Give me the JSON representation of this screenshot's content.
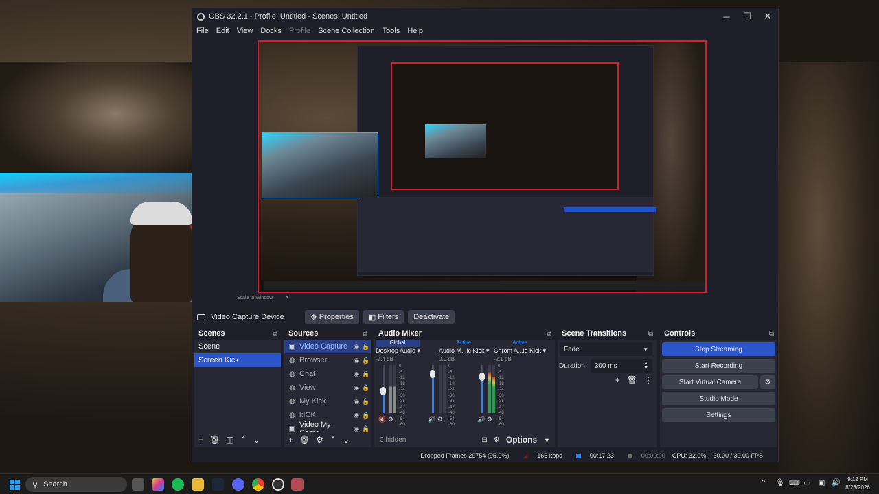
{
  "window": {
    "title": "OBS 32.2.1 - Profile: Untitled - Scenes: Untitled",
    "minimize": "─",
    "maximize": "☐",
    "close": "✕"
  },
  "menu": [
    "File",
    "Edit",
    "View",
    "Docks",
    "Profile",
    "Scene Collection",
    "Tools",
    "Help"
  ],
  "preview": {
    "scale_label": "Scale to Window"
  },
  "source_toolbar": {
    "source_name": "Video Capture Device",
    "properties": "Properties",
    "filters": "Filters",
    "deactivate": "Deactivate"
  },
  "scenes": {
    "title": "Scenes",
    "items": [
      "Scene",
      "Screen Kick"
    ],
    "active_index": 1
  },
  "sources": {
    "title": "Sources",
    "items": [
      "Video Capture",
      "Browser",
      "Chat",
      "View",
      "My Kick",
      "kICK",
      "Video My Came"
    ]
  },
  "mixer": {
    "title": "Audio Mixer",
    "channels": [
      {
        "tab": "Global",
        "name": "Desktop Audio",
        "db": "-7.4 dB",
        "level": 0.45
      },
      {
        "tab": "Active",
        "name": "Audio M...lc Kick",
        "db": "0.0 dB",
        "level": 0.82
      },
      {
        "tab": "Active",
        "name": "Chrom A...lo Kick",
        "db": "-2.1 dB",
        "level": 0.75
      }
    ],
    "scale": [
      "0",
      "-5",
      "-12",
      "-18",
      "-24",
      "-30",
      "-36",
      "-42",
      "-48",
      "-54",
      "-60"
    ],
    "hidden": "0 hidden",
    "options": "Options"
  },
  "transitions": {
    "title": "Scene Transitions",
    "type": "Fade",
    "duration_label": "Duration",
    "duration": "300 ms"
  },
  "controls": {
    "title": "Controls",
    "stop_streaming": "Stop Streaming",
    "start_recording": "Start Recording",
    "start_virtual_camera": "Start Virtual Camera",
    "studio_mode": "Studio Mode",
    "settings": "Settings"
  },
  "status": {
    "dropped": "Dropped Frames 29754 (95.0%)",
    "bitrate": "166 kbps",
    "stream_time": "00:17:23",
    "rec_time": "00:00:00",
    "cpu": "CPU: 32.0%",
    "fps": "30.00 / 30.00 FPS"
  },
  "taskbar": {
    "search": "Search",
    "time": "9:12 PM",
    "date": "8/23/2026"
  },
  "colors": {
    "accent": "#2b55c9",
    "stream_red": "#d4202c",
    "dock_bg": "#272833",
    "window_bg": "#1e1f29"
  }
}
